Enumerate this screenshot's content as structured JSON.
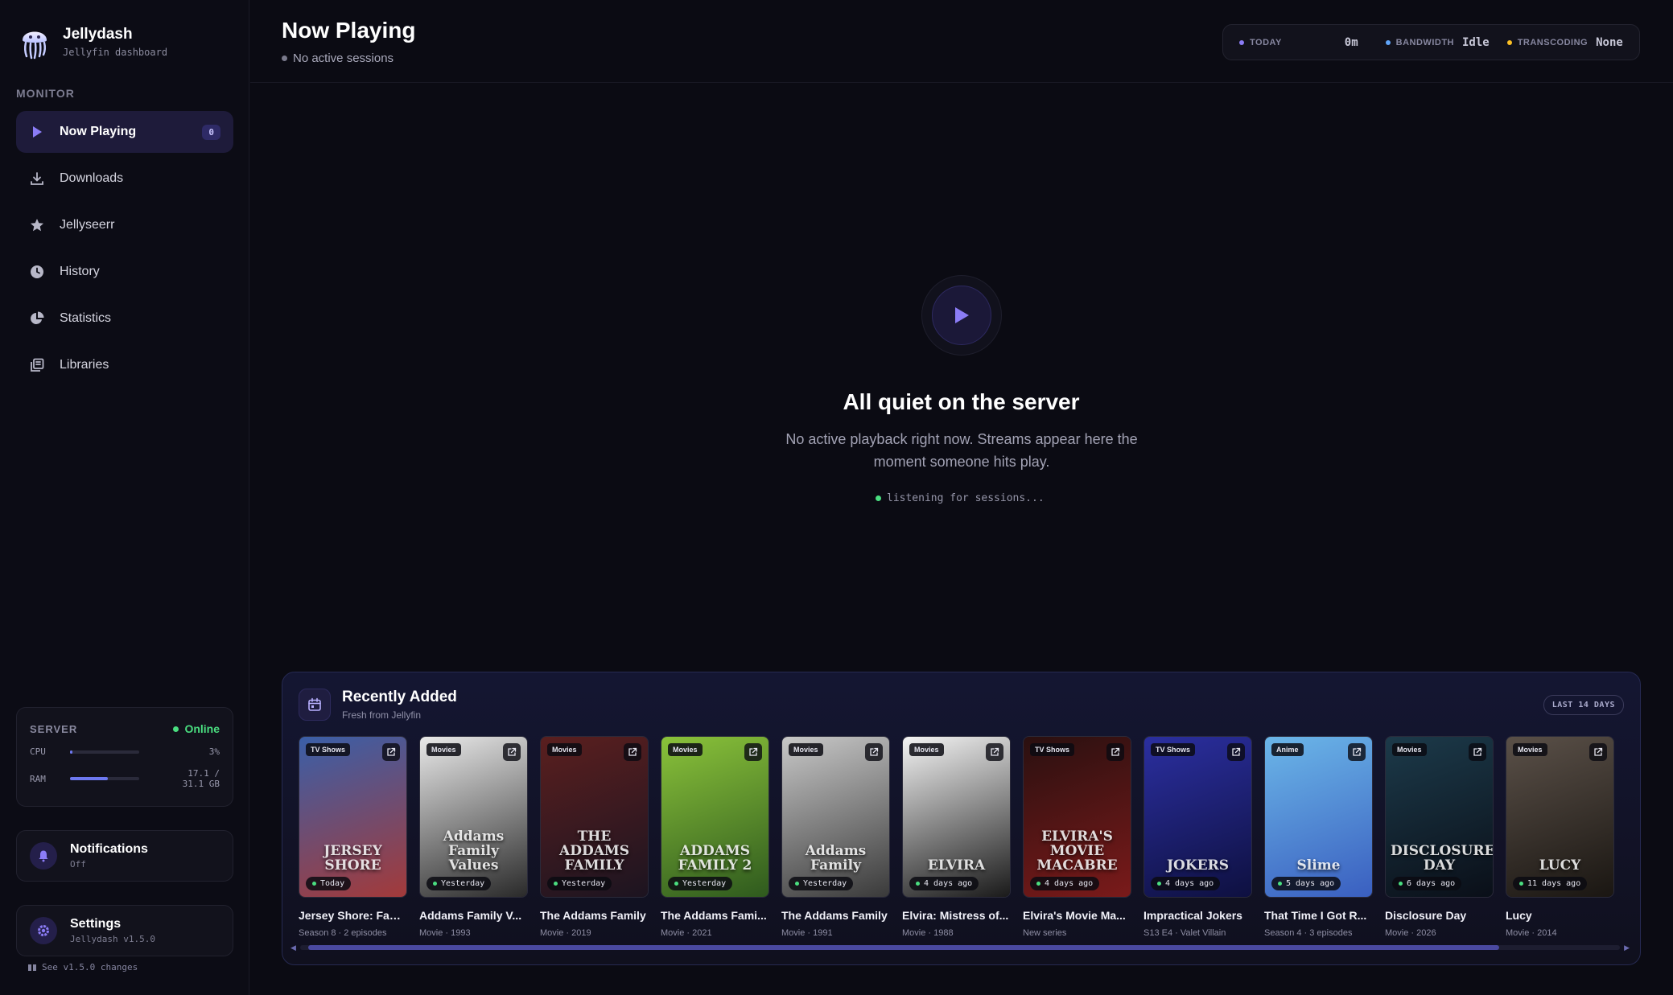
{
  "brand": {
    "title": "Jellydash",
    "subtitle": "Jellyfin dashboard"
  },
  "nav": {
    "section_label": "MONITOR",
    "items": [
      {
        "label": "Now Playing",
        "icon": "play-icon",
        "badge": "0",
        "active": true
      },
      {
        "label": "Downloads",
        "icon": "download-icon"
      },
      {
        "label": "Jellyseerr",
        "icon": "star-icon"
      },
      {
        "label": "History",
        "icon": "clock-icon"
      },
      {
        "label": "Statistics",
        "icon": "pie-chart-icon"
      },
      {
        "label": "Libraries",
        "icon": "library-icon"
      }
    ]
  },
  "server": {
    "label": "SERVER",
    "status": "Online",
    "cpu": {
      "label": "CPU",
      "value": "3%",
      "fraction": 0.03
    },
    "ram": {
      "label": "RAM",
      "value": "17.1 / 31.1 GB",
      "fraction": 0.55
    }
  },
  "notifications": {
    "title": "Notifications",
    "status": "Off"
  },
  "settings": {
    "title": "Settings",
    "version": "Jellydash v1.5.0"
  },
  "changes_link": "See v1.5.0 changes",
  "header": {
    "title": "Now Playing",
    "subtitle": "No active sessions",
    "stats": [
      {
        "label": "TODAY",
        "value": "0m",
        "color": "#8b7cf6"
      },
      {
        "label": "BANDWIDTH",
        "value": "Idle",
        "color": "#60a5fa"
      },
      {
        "label": "TRANSCODING",
        "value": "None",
        "color": "#fbbf24"
      }
    ]
  },
  "empty": {
    "title": "All quiet on the server",
    "text": "No active playback right now. Streams appear here the moment someone hits play.",
    "listening": "listening for sessions..."
  },
  "recent": {
    "title": "Recently Added",
    "subtitle": "Fresh from Jellyfin",
    "range": "LAST 14 DAYS",
    "items": [
      {
        "title": "Jersey Shore: Fam...",
        "type": "TV Shows",
        "when": "Today",
        "meta": "Season 8 · 2 episodes",
        "poster_text": "JERSEY SHORE",
        "colors": [
          "#3a5fa8",
          "#a33a3a"
        ]
      },
      {
        "title": "Addams Family V...",
        "type": "Movies",
        "when": "Yesterday",
        "meta": "Movie · 1993",
        "poster_text": "Addams Family Values",
        "colors": [
          "#e9e9e9",
          "#2a2a2a"
        ]
      },
      {
        "title": "The Addams Family",
        "type": "Movies",
        "when": "Yesterday",
        "meta": "Movie · 2019",
        "poster_text": "THE ADDAMS FAMILY",
        "colors": [
          "#5a1f1f",
          "#1c1420"
        ]
      },
      {
        "title": "The Addams Fami...",
        "type": "Movies",
        "when": "Yesterday",
        "meta": "Movie · 2021",
        "poster_text": "ADDAMS FAMILY 2",
        "colors": [
          "#8ac23a",
          "#2f5a1e"
        ]
      },
      {
        "title": "The Addams Family",
        "type": "Movies",
        "when": "Yesterday",
        "meta": "Movie · 1991",
        "poster_text": "Addams Family",
        "colors": [
          "#c8c8c8",
          "#3a3a3a"
        ]
      },
      {
        "title": "Elvira: Mistress of...",
        "type": "Movies",
        "when": "4 days ago",
        "meta": "Movie · 1988",
        "poster_text": "ELVIRA",
        "colors": [
          "#f4f4f4",
          "#1a1a1a"
        ]
      },
      {
        "title": "Elvira's Movie Ma...",
        "type": "TV Shows",
        "when": "4 days ago",
        "meta": "New series",
        "poster_text": "ELVIRA'S MOVIE MACABRE",
        "colors": [
          "#2a1010",
          "#7a1a1a"
        ]
      },
      {
        "title": "Impractical Jokers",
        "type": "TV Shows",
        "when": "4 days ago",
        "meta": "S13 E4 · Valet Villain",
        "poster_text": "JOKERS",
        "colors": [
          "#2b2fa0",
          "#0e1040"
        ]
      },
      {
        "title": "That Time I Got R...",
        "type": "Anime",
        "when": "5 days ago",
        "meta": "Season 4 · 3 episodes",
        "poster_text": "Slime",
        "colors": [
          "#6bb6e8",
          "#3a5fc0"
        ]
      },
      {
        "title": "Disclosure Day",
        "type": "Movies",
        "when": "6 days ago",
        "meta": "Movie · 2026",
        "poster_text": "DISCLOSURE DAY",
        "colors": [
          "#1c3a4a",
          "#0a0f18"
        ]
      },
      {
        "title": "Lucy",
        "type": "Movies",
        "when": "11 days ago",
        "meta": "Movie · 2014",
        "poster_text": "LUCY",
        "colors": [
          "#5a5048",
          "#1a1612"
        ]
      }
    ]
  }
}
